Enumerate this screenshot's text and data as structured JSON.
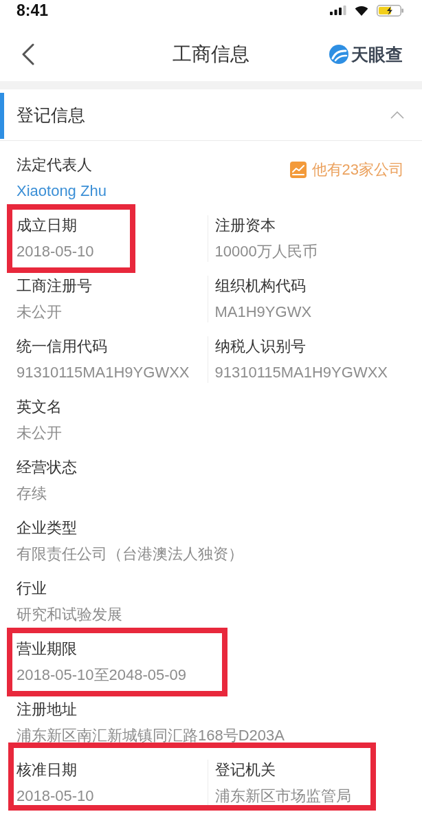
{
  "status_bar": {
    "time": "8:41"
  },
  "nav": {
    "title": "工商信息",
    "brand": "天眼查"
  },
  "section": {
    "title": "登记信息",
    "expanded": true,
    "representative": {
      "label": "法定代表人",
      "name": "Xiaotong Zhu",
      "companies": "他有23家公司"
    },
    "rows": [
      {
        "highlighted": false,
        "fields": [
          {
            "label": "成立日期",
            "value": "2018-05-10",
            "highlighted": true
          },
          {
            "label": "注册资本",
            "value": "10000万人民币",
            "highlighted": false
          }
        ]
      },
      {
        "highlighted": false,
        "fields": [
          {
            "label": "工商注册号",
            "value": "未公开",
            "highlighted": false
          },
          {
            "label": "组织机构代码",
            "value": "MA1H9YGWX",
            "highlighted": false
          }
        ]
      },
      {
        "highlighted": false,
        "fields": [
          {
            "label": "统一信用代码",
            "value": "91310115MA1H9YGWXX",
            "highlighted": false
          },
          {
            "label": "纳税人识别号",
            "value": "91310115MA1H9YGWXX",
            "highlighted": false
          }
        ]
      },
      {
        "highlighted": false,
        "fields": [
          {
            "label": "英文名",
            "value": "未公开",
            "highlighted": false
          }
        ]
      },
      {
        "highlighted": false,
        "fields": [
          {
            "label": "经营状态",
            "value": "存续",
            "highlighted": false
          }
        ]
      },
      {
        "highlighted": false,
        "fields": [
          {
            "label": "企业类型",
            "value": "有限责任公司（台港澳法人独资）",
            "highlighted": false
          }
        ]
      },
      {
        "highlighted": false,
        "fields": [
          {
            "label": "行业",
            "value": "研究和试验发展",
            "highlighted": false
          }
        ]
      },
      {
        "highlighted": false,
        "fields": [
          {
            "label": "营业期限",
            "value": "2018-05-10至2048-05-09",
            "highlighted": true
          }
        ]
      },
      {
        "highlighted": false,
        "fields": [
          {
            "label": "注册地址",
            "value": "浦东新区南汇新城镇同汇路168号D203A",
            "highlighted": false
          }
        ]
      },
      {
        "highlighted": true,
        "fields": [
          {
            "label": "核准日期",
            "value": "2018-05-10",
            "highlighted": false
          },
          {
            "label": "登记机关",
            "value": "浦东新区市场监管局",
            "highlighted": false
          }
        ]
      }
    ]
  }
}
